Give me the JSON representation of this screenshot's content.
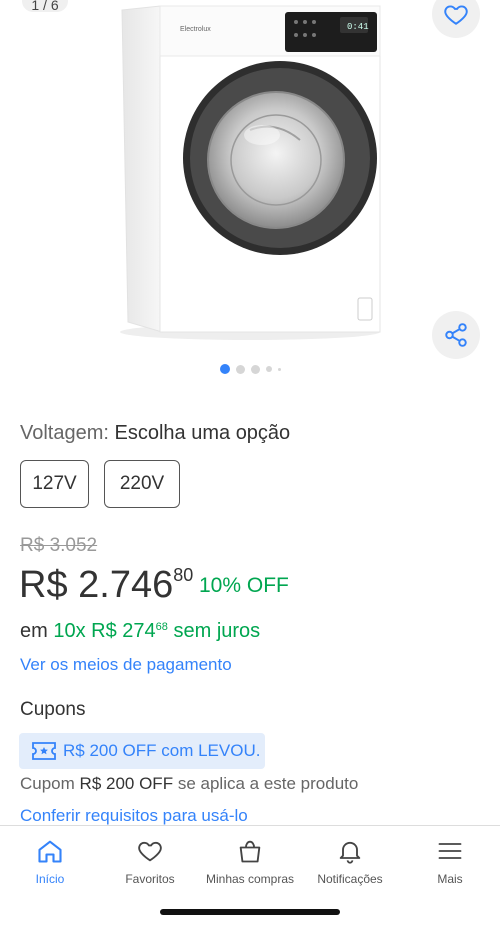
{
  "gallery": {
    "counter": "1 / 6",
    "dots_count": 5,
    "active_dot": 0,
    "product_image_icon": "washing-machine",
    "favorite_icon": "heart-icon",
    "share_icon": "share-icon"
  },
  "variation": {
    "label": "Voltagem:",
    "value": "Escolha uma opção",
    "options": [
      "127V",
      "220V"
    ]
  },
  "price": {
    "original": "R$ 3.052",
    "currency": "R$",
    "integer": "2.746",
    "cents": "80",
    "discount": "10% OFF",
    "installments_prefix": "em",
    "installments_count": "10x",
    "installments_value": "R$ 274",
    "installments_cents": "68",
    "installments_suffix": "sem juros",
    "payment_link": "Ver os meios de pagamento"
  },
  "coupons": {
    "title": "Cupons",
    "chip_text": "R$ 200 OFF com LEVOU.",
    "note_prefix": "Cupom",
    "note_amount": "R$ 200 OFF",
    "note_suffix": "se aplica a este produto",
    "requirements_link": "Conferir requisitos para usá-lo"
  },
  "bottom_nav": {
    "items": [
      {
        "label": "Início",
        "icon": "home-icon",
        "active": true
      },
      {
        "label": "Favoritos",
        "icon": "heart-icon",
        "active": false
      },
      {
        "label": "Minhas compras",
        "icon": "bag-icon",
        "active": false
      },
      {
        "label": "Notificações",
        "icon": "bell-icon",
        "active": false
      },
      {
        "label": "Mais",
        "icon": "menu-icon",
        "active": false
      }
    ]
  },
  "colors": {
    "accent": "#3483fa",
    "discount_green": "#00a650",
    "coupon_bg": "#e3edfb"
  }
}
